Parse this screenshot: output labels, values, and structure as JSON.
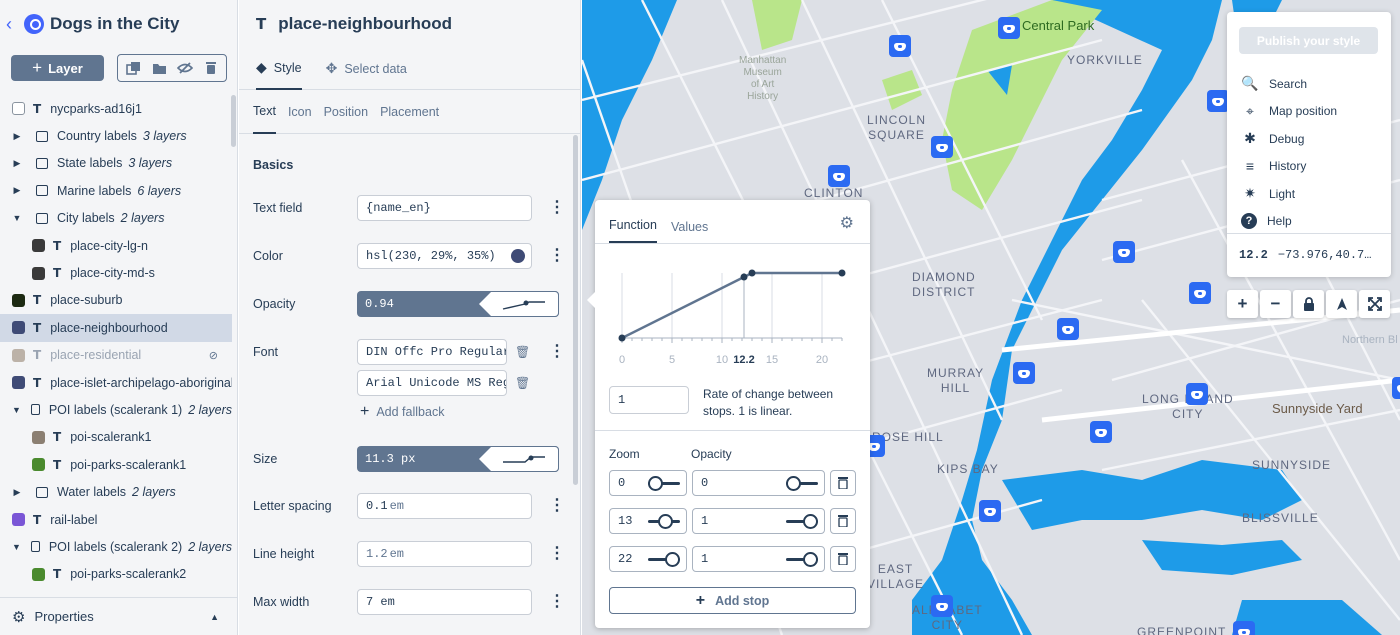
{
  "app": {
    "back_icon": "back-chevron-icon",
    "title": "Dogs in the City"
  },
  "toolbar": {
    "layer_label": "Layer"
  },
  "layers": [
    {
      "name": "nycparks-ad16j1",
      "count": "",
      "type": "text",
      "swatch": "#8a949f",
      "caret": ""
    },
    {
      "name": "Country labels",
      "count": "3 layers",
      "type": "folder",
      "caret": "▶"
    },
    {
      "name": "State labels",
      "count": "3 layers",
      "type": "folder",
      "caret": "▶"
    },
    {
      "name": "Marine labels",
      "count": "6 layers",
      "type": "folder",
      "caret": "▶"
    },
    {
      "name": "City labels",
      "count": "2 layers",
      "type": "folder",
      "caret": "▼"
    },
    {
      "name": "place-city-lg-n",
      "count": "",
      "type": "text",
      "swatch": "#3a3a3a",
      "caret": "",
      "indent": true
    },
    {
      "name": "place-city-md-s",
      "count": "",
      "type": "text",
      "swatch": "#3a3a3a",
      "caret": "",
      "indent": true
    },
    {
      "name": "place-suburb",
      "count": "",
      "type": "text",
      "swatch": "#1d2a12",
      "caret": ""
    },
    {
      "name": "place-neighbourhood",
      "count": "",
      "type": "text",
      "swatch": "#3f4b76",
      "caret": "",
      "selected": true
    },
    {
      "name": "place-residential",
      "count": "",
      "type": "text",
      "swatch": "#bcb2a8",
      "caret": "",
      "hidden": true
    },
    {
      "name": "place-islet-archipelago-aboriginal",
      "count": "",
      "type": "text",
      "swatch": "#3f4b76",
      "caret": ""
    },
    {
      "name": "POI labels (scalerank 1)",
      "count": "2 layers",
      "type": "folder",
      "caret": "▼"
    },
    {
      "name": "poi-scalerank1",
      "count": "",
      "type": "text",
      "swatch": "#8b7f72",
      "caret": "",
      "indent": true
    },
    {
      "name": "poi-parks-scalerank1",
      "count": "",
      "type": "text",
      "swatch": "#4a8a2e",
      "caret": "",
      "indent": true
    },
    {
      "name": "Water labels",
      "count": "2 layers",
      "type": "folder",
      "caret": "▶"
    },
    {
      "name": "rail-label",
      "count": "",
      "type": "text",
      "swatch": "#7a56d6",
      "caret": ""
    },
    {
      "name": "POI labels (scalerank 2)",
      "count": "2 layers",
      "type": "folder",
      "caret": "▼"
    },
    {
      "name": "poi-parks-scalerank2",
      "count": "",
      "type": "text",
      "swatch": "#4a8a2e",
      "caret": "",
      "indent": true
    }
  ],
  "properties_label": "Properties",
  "panel": {
    "title": "place-neighbourhood",
    "tab_style": "Style",
    "tab_select": "Select data",
    "subtabs": [
      "Text",
      "Icon",
      "Position",
      "Placement"
    ],
    "section": "Basics",
    "text_field": {
      "label": "Text field",
      "value": "{name_en}"
    },
    "color": {
      "label": "Color",
      "value": "hsl(230, 29%, 35%)",
      "swatch": "#3f4b76"
    },
    "opacity": {
      "label": "Opacity",
      "value": "0.94"
    },
    "font": {
      "label": "Font",
      "values": [
        "DIN Offc Pro Regular",
        "Arial Unicode MS Reg"
      ],
      "add_fallback": "Add fallback"
    },
    "size": {
      "label": "Size",
      "value": "11.3 px"
    },
    "letter_spacing": {
      "label": "Letter spacing",
      "value": "0.1",
      "unit": "em"
    },
    "line_height": {
      "label": "Line height",
      "value": "1.2",
      "unit": "em"
    },
    "max_width": {
      "label": "Max width",
      "value": "7 em"
    }
  },
  "function_popup": {
    "tabs": [
      "Function",
      "Values"
    ],
    "graph": {
      "x_ticks": [
        "0",
        "5",
        "10",
        "12.2",
        "15",
        "20"
      ],
      "current_zoom": "12.2"
    },
    "rate_value": "1",
    "rate_text": "Rate of change between stops. 1 is linear.",
    "col_zoom": "Zoom",
    "col_opacity": "Opacity",
    "stops": [
      {
        "zoom": "0",
        "value": "0",
        "zoom_slider": 0.0,
        "value_slider": 0.0
      },
      {
        "zoom": "13",
        "value": "1",
        "zoom_slider": 0.59,
        "value_slider": 1.0
      },
      {
        "zoom": "22",
        "value": "1",
        "zoom_slider": 1.0,
        "value_slider": 1.0
      }
    ],
    "add_stop": "Add stop"
  },
  "menu": {
    "publish": "Publish your style",
    "items": [
      {
        "label": "Search",
        "icon": "search-icon"
      },
      {
        "label": "Map position",
        "icon": "crosshair-icon"
      },
      {
        "label": "Debug",
        "icon": "bug-icon"
      },
      {
        "label": "History",
        "icon": "history-icon"
      },
      {
        "label": "Light",
        "icon": "light-icon"
      },
      {
        "label": "Help",
        "icon": "help-icon"
      }
    ],
    "zoom": "12.2",
    "coords": "−73.976,40.7…"
  },
  "map": {
    "labels": [
      "Central Park",
      "YORKVILLE",
      "LINCOLN\nSQUARE",
      "CLINTON",
      "DIAMOND\nDISTRICT",
      "MURRAY\nHILL",
      "ROSE HILL",
      "KIPS BAY",
      "EAST\nVILLAGE",
      "ALPHABET\nCITY",
      "LONG ISLAND\nCITY",
      "Sunnyside Yard",
      "SUNNYSIDE",
      "BLISSVILLE",
      "GREENPOINT",
      "Northern Bl",
      "Manhattan\nMuseum\nof Art\nHistory"
    ]
  }
}
